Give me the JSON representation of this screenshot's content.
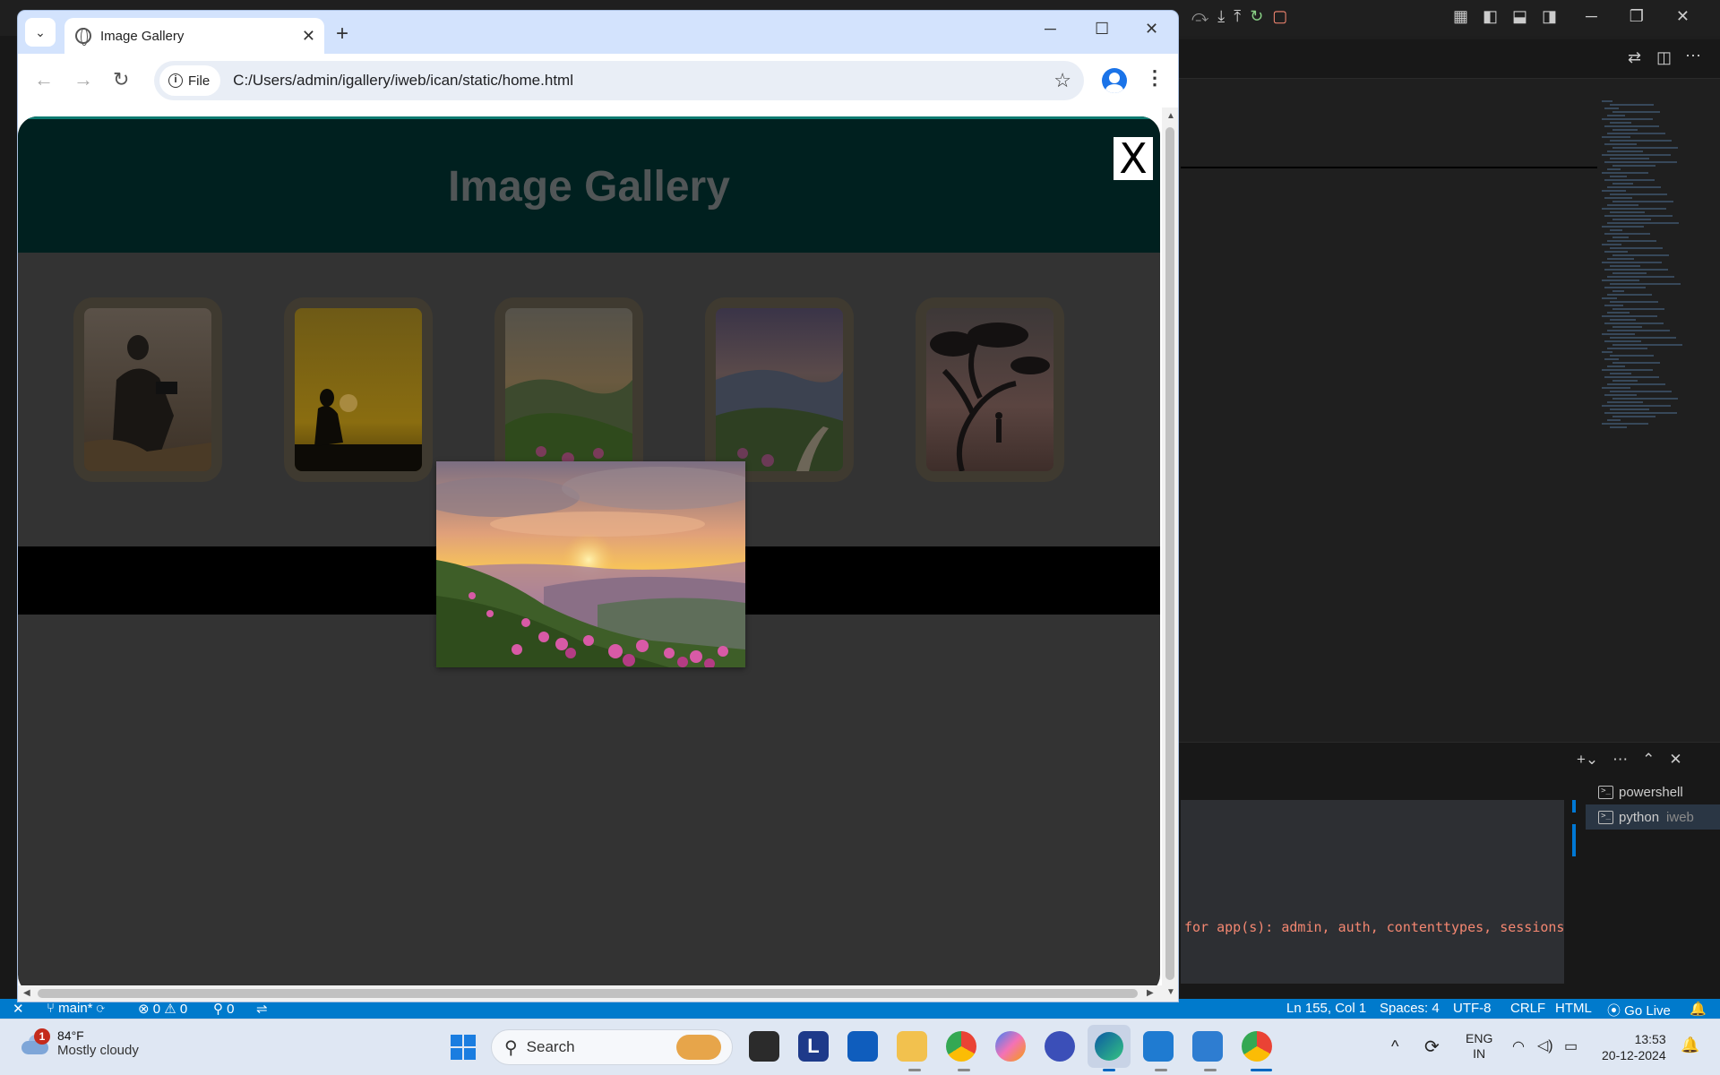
{
  "browser": {
    "tab_title": "Image Gallery",
    "new_tab_symbol": "+",
    "address_chip": "File",
    "url": "C:/Users/admin/igallery/iweb/ican/static/home.html"
  },
  "page": {
    "title": "Image Gallery",
    "close_label": "X",
    "thumbnails": [
      {
        "subject": "photographer-with-camera"
      },
      {
        "subject": "silhouette-at-sunset"
      },
      {
        "subject": "mountain-flowers-sunset"
      },
      {
        "subject": "mountain-valley-path"
      },
      {
        "subject": "tree-silhouette-person"
      }
    ],
    "modal_image": {
      "subject": "mountain-flowers-sunset"
    }
  },
  "vscode": {
    "terminal_output": "for app(s): admin, auth, contenttypes, sessions",
    "terminals": [
      {
        "name": "powershell",
        "sub": ""
      },
      {
        "name": "python",
        "sub": "iweb"
      }
    ],
    "status": {
      "branch": "main*",
      "errors": "0",
      "warnings": "0",
      "ports": "0",
      "cursor": "Ln 155, Col 1",
      "spaces": "Spaces: 4",
      "encoding": "UTF-8",
      "eol": "CRLF",
      "language": "HTML",
      "golive": "Go Live"
    }
  },
  "taskbar": {
    "weather_badge": "1",
    "temperature": "84°F",
    "condition": "Mostly cloudy",
    "search_placeholder": "Search",
    "language_line1": "ENG",
    "language_line2": "IN",
    "time": "13:53",
    "date": "20-12-2024"
  },
  "colors": {
    "page_bg": "#333333",
    "header_bg": "#00201f",
    "statusbar": "#007acc",
    "accent": "#0d7a70"
  }
}
